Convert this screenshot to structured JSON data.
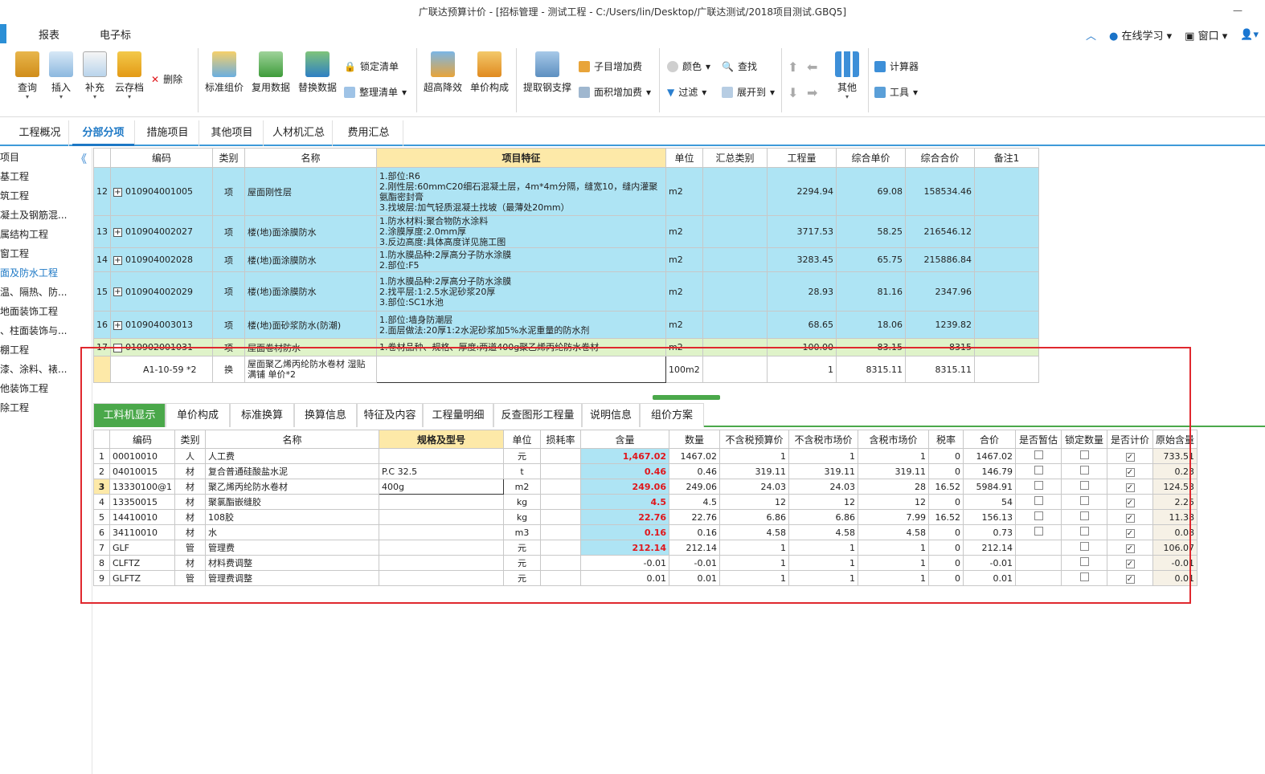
{
  "title": "广联达预算计价 - [招标管理 - 测试工程 - C:/Users/lin/Desktop/广联达测试/2018项目测试.GBQ5]",
  "menubar": {
    "items": [
      "报表",
      "电子标"
    ],
    "right": {
      "online_learning": "在线学习",
      "window": "窗口"
    }
  },
  "ribbon": {
    "query": "查询",
    "insert": "插入",
    "supplement": "补充",
    "cloud": "云存档",
    "delete": "删除",
    "std_group": "标准组价",
    "reuse_data": "复用数据",
    "replace_data": "替换数据",
    "lock_list": "锁定清单",
    "sort_list": "整理清单",
    "super_height": "超高降效",
    "unit_price": "单价构成",
    "extract_steel": "提取钢支撑",
    "sub_increase": "子目增加费",
    "area_increase": "面积增加费",
    "color": "颜色",
    "find": "查找",
    "filter": "过滤",
    "expand": "展开到",
    "other": "其他",
    "calculator": "计算器",
    "tools": "工具"
  },
  "tabs": [
    "工程概况",
    "分部分项",
    "措施项目",
    "其他项目",
    "人材机汇总",
    "费用汇总"
  ],
  "sidebar": {
    "items": [
      "项目",
      "基工程",
      "筑工程",
      "凝土及钢筋混...",
      "属结构工程",
      "窗工程",
      "面及防水工程",
      "温、隔热、防...",
      "地面装饰工程",
      "、柱面装饰与...",
      "棚工程",
      "漆、涂料、裱...",
      "他装饰工程",
      "除工程"
    ]
  },
  "upper_grid": {
    "headers": [
      "编码",
      "类别",
      "名称",
      "项目特征",
      "单位",
      "汇总类别",
      "工程量",
      "综合单价",
      "综合合价",
      "备注1"
    ],
    "rows": [
      {
        "no": "12",
        "code": "010904001005",
        "type": "项",
        "name": "屋面刚性层",
        "feature": "1.部位:R6\n2.刚性层:60mmC20细石混凝土层，4m*4m分隔，缝宽10，缝内灌聚氨酯密封膏\n3.找坡层:加气轻质混凝土找坡（最薄处20mm）",
        "unit": "m2",
        "qty": "2294.94",
        "price": "69.08",
        "total": "158534.46"
      },
      {
        "no": "13",
        "code": "010904002027",
        "type": "项",
        "name": "楼(地)面涂膜防水",
        "feature": "1.防水材料:聚合物防水涂料\n2.涂膜厚度:2.0mm厚\n3.反边高度:具体高度详见施工图",
        "unit": "m2",
        "qty": "3717.53",
        "price": "58.25",
        "total": "216546.12"
      },
      {
        "no": "14",
        "code": "010904002028",
        "type": "项",
        "name": "楼(地)面涂膜防水",
        "feature": "1.防水膜品种:2厚高分子防水涂膜\n2.部位:F5",
        "unit": "m2",
        "qty": "3283.45",
        "price": "65.75",
        "total": "215886.84"
      },
      {
        "no": "15",
        "code": "010904002029",
        "type": "项",
        "name": "楼(地)面涂膜防水",
        "feature": "1.防水膜品种:2厚高分子防水涂膜\n2.找平层:1:2.5水泥砂浆20厚\n3.部位:SC1水池",
        "unit": "m2",
        "qty": "28.93",
        "price": "81.16",
        "total": "2347.96"
      },
      {
        "no": "16",
        "code": "010904003013",
        "type": "项",
        "name": "楼(地)面砂浆防水(防潮)",
        "feature": "1.部位:墙身防潮层\n2.面层做法:20厚1:2水泥砂浆加5%水泥重量的防水剂",
        "unit": "m2",
        "qty": "68.65",
        "price": "18.06",
        "total": "1239.82"
      },
      {
        "no": "17",
        "code": "010902001031",
        "type": "项",
        "name": "屋面卷材防水",
        "feature": "1.卷材品种、规格、厚度:两道400g聚乙烯丙纶防水卷材",
        "unit": "m2",
        "qty": "100.00",
        "price": "83.15",
        "total": "8315"
      },
      {
        "no": "",
        "code": "A1-10-59 *2",
        "type": "换",
        "name": "屋面聚乙烯丙纶防水卷材 湿贴 满铺  单价*2",
        "feature": "",
        "unit": "100m2",
        "qty": "1",
        "price": "8315.11",
        "total": "8315.11"
      }
    ]
  },
  "detail_tabs": [
    "工料机显示",
    "单价构成",
    "标准换算",
    "换算信息",
    "特征及内容",
    "工程量明细",
    "反查图形工程量",
    "说明信息",
    "组价方案"
  ],
  "lower_grid": {
    "headers": [
      "编码",
      "类别",
      "名称",
      "规格及型号",
      "单位",
      "损耗率",
      "含量",
      "数量",
      "不含税预算价",
      "不含税市场价",
      "含税市场价",
      "税率",
      "合价",
      "是否暂估",
      "锁定数量",
      "是否计价",
      "原始含量"
    ],
    "rows": [
      {
        "no": "1",
        "code": "00010010",
        "type": "人",
        "name": "人工费",
        "spec": "",
        "unit": "元",
        "loss": "",
        "content": "1,467.02",
        "amount": "1467.02",
        "pre": "1",
        "mkt": "1",
        "taxmkt": "1",
        "rate": "0",
        "sum": "1467.02",
        "est": false,
        "lock": false,
        "price": true,
        "orig": "733.51"
      },
      {
        "no": "2",
        "code": "04010015",
        "type": "材",
        "name": "复合普通硅酸盐水泥",
        "spec": "P.C 32.5",
        "unit": "t",
        "loss": "",
        "content": "0.46",
        "amount": "0.46",
        "pre": "319.11",
        "mkt": "319.11",
        "taxmkt": "319.11",
        "rate": "0",
        "sum": "146.79",
        "est": false,
        "lock": false,
        "price": true,
        "orig": "0.23"
      },
      {
        "no": "3",
        "code": "13330100@1",
        "type": "材",
        "name": "聚乙烯丙纶防水卷材",
        "spec": "400g",
        "unit": "m2",
        "loss": "",
        "content": "249.06",
        "amount": "249.06",
        "pre": "24.03",
        "mkt": "24.03",
        "taxmkt": "28",
        "rate": "16.52",
        "sum": "5984.91",
        "est": false,
        "lock": false,
        "price": true,
        "orig": "124.53"
      },
      {
        "no": "4",
        "code": "13350015",
        "type": "材",
        "name": "聚氯酯嵌缝胶",
        "spec": "",
        "unit": "kg",
        "loss": "",
        "content": "4.5",
        "amount": "4.5",
        "pre": "12",
        "mkt": "12",
        "taxmkt": "12",
        "rate": "0",
        "sum": "54",
        "est": false,
        "lock": false,
        "price": true,
        "orig": "2.25"
      },
      {
        "no": "5",
        "code": "14410010",
        "type": "材",
        "name": "108胶",
        "spec": "",
        "unit": "kg",
        "loss": "",
        "content": "22.76",
        "amount": "22.76",
        "pre": "6.86",
        "mkt": "6.86",
        "taxmkt": "7.99",
        "rate": "16.52",
        "sum": "156.13",
        "est": false,
        "lock": false,
        "price": true,
        "orig": "11.38"
      },
      {
        "no": "6",
        "code": "34110010",
        "type": "材",
        "name": "水",
        "spec": "",
        "unit": "m3",
        "loss": "",
        "content": "0.16",
        "amount": "0.16",
        "pre": "4.58",
        "mkt": "4.58",
        "taxmkt": "4.58",
        "rate": "0",
        "sum": "0.73",
        "est": false,
        "lock": false,
        "price": true,
        "orig": "0.08"
      },
      {
        "no": "7",
        "code": "GLF",
        "type": "管",
        "name": "管理费",
        "spec": "",
        "unit": "元",
        "loss": "",
        "content": "212.14",
        "amount": "212.14",
        "pre": "1",
        "mkt": "1",
        "taxmkt": "1",
        "rate": "0",
        "sum": "212.14",
        "est": false,
        "lock": false,
        "price": true,
        "orig": "106.07"
      },
      {
        "no": "8",
        "code": "CLFTZ",
        "type": "材",
        "name": "材料费调整",
        "spec": "",
        "unit": "元",
        "loss": "",
        "content": "-0.01",
        "amount": "-0.01",
        "pre": "1",
        "mkt": "1",
        "taxmkt": "1",
        "rate": "0",
        "sum": "-0.01",
        "est": false,
        "lock": false,
        "price": true,
        "orig": "-0.01"
      },
      {
        "no": "9",
        "code": "GLFTZ",
        "type": "管",
        "name": "管理费调整",
        "spec": "",
        "unit": "元",
        "loss": "",
        "content": "0.01",
        "amount": "0.01",
        "pre": "1",
        "mkt": "1",
        "taxmkt": "1",
        "rate": "0",
        "sum": "0.01",
        "est": false,
        "lock": false,
        "price": true,
        "orig": "0.01"
      }
    ]
  },
  "colors": {
    "accent": "#1d78c5",
    "row_blue": "#aee4f4",
    "row_green": "#dff3c9",
    "feature_header": "#fde9a8",
    "highlight_box": "#e0282e",
    "detail_tab": "#4aa84a"
  }
}
